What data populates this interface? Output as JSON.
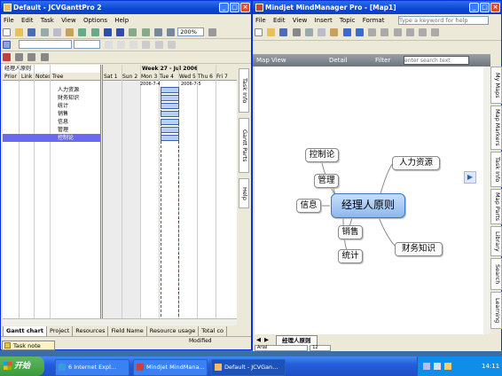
{
  "left_window": {
    "title": "Default - JCVGanttPro 2",
    "menu": [
      "File",
      "Edit",
      "Task",
      "View",
      "Options",
      "Help"
    ],
    "zoom": "200%",
    "project_name": "经理人原则",
    "col_headers": [
      "Prior",
      "Link",
      "Notes",
      "Tree"
    ],
    "week_label": "Week 27 - Jul 2006",
    "days": [
      "Sat 1",
      "Sun 2",
      "Mon 3",
      "Tue 4",
      "Wed 5",
      "Thu 6",
      "Fri 7"
    ],
    "date_start": "2006-7-4",
    "date_end": "2006-7-5",
    "tasks": [
      "人力资源",
      "财务知识",
      "统计",
      "销售",
      "信息",
      "管理",
      "控制论"
    ],
    "bottom_tabs": [
      "Gantt chart",
      "Project",
      "Resources",
      "Field Name",
      "Resource usage",
      "Total co"
    ],
    "side_tabs": [
      "Task Info",
      "Gantt Parts",
      "Help"
    ],
    "task_note": "Task note",
    "status": "Modified"
  },
  "right_window": {
    "title": "Mindjet MindManager Pro - [Map1]",
    "menu": [
      "File",
      "Edit",
      "View",
      "Insert",
      "Topic",
      "Format"
    ],
    "help_placeholder": "Type a keyword for help",
    "map_view": "Map View",
    "detail": "Detail",
    "filter": "Filter",
    "search_placeholder": "enter search text",
    "central_topic": "经理人原则",
    "topics_left": [
      "控制论",
      "管理",
      "信息",
      "销售",
      "统计"
    ],
    "topics_right": [
      "人力资源",
      "财务知识"
    ],
    "sheet_tab": "经理人原则",
    "font": "Arial",
    "font_size": "12",
    "side_tabs": [
      "My Maps",
      "Map Markers",
      "Task Info",
      "Map Parts",
      "Library",
      "Search",
      "Learning"
    ]
  },
  "taskbar": {
    "start": "开始",
    "buttons": [
      "6 Internet Expl...",
      "Mindjet MindMana...",
      "Default - JCVGan..."
    ],
    "clock": "14:11"
  }
}
